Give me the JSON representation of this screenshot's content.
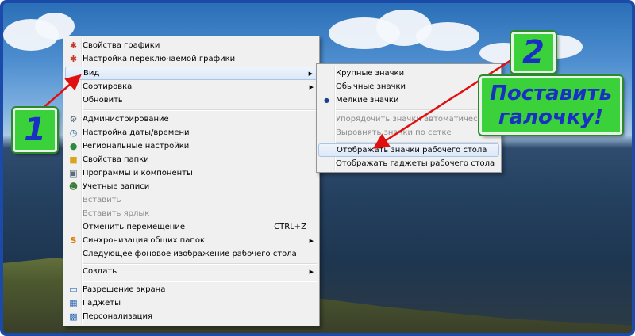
{
  "context_menu": {
    "items": [
      {
        "label": "Свойства графики",
        "icon": "intel-graphics-icon"
      },
      {
        "label": "Настройка переключаемой графики",
        "icon": "intel-graphics-icon"
      },
      {
        "label": "Вид",
        "submenu": true
      },
      {
        "label": "Сортировка",
        "submenu": true
      },
      {
        "label": "Обновить"
      },
      {
        "label": "Администрирование",
        "icon": "admin-tools-icon"
      },
      {
        "label": "Настройка даты/времени",
        "icon": "clock-icon"
      },
      {
        "label": "Региональные настройки",
        "icon": "globe-icon"
      },
      {
        "label": "Свойства папки",
        "icon": "folder-options-icon"
      },
      {
        "label": "Программы и компоненты",
        "icon": "programs-icon"
      },
      {
        "label": "Учетные записи",
        "icon": "users-icon"
      },
      {
        "label": "Вставить",
        "disabled": true
      },
      {
        "label": "Вставить ярлык",
        "disabled": true
      },
      {
        "label": "Отменить перемещение",
        "shortcut": "CTRL+Z"
      },
      {
        "label": "Синхронизация общих папок",
        "icon": "sync-icon",
        "submenu": true
      },
      {
        "label": "Следующее фоновое изображение рабочего стола"
      },
      {
        "label": "Создать",
        "submenu": true
      },
      {
        "label": "Разрешение экрана",
        "icon": "display-icon"
      },
      {
        "label": "Гаджеты",
        "icon": "gadgets-icon"
      },
      {
        "label": "Персонализация",
        "icon": "personalization-icon"
      }
    ]
  },
  "view_submenu": {
    "items": [
      {
        "label": "Крупные значки"
      },
      {
        "label": "Обычные значки"
      },
      {
        "label": "Мелкие значки",
        "selected": true
      },
      {
        "label": "Упорядочить значки автоматически",
        "disabled": true
      },
      {
        "label": "Выровнять значки по сетке",
        "disabled": true
      },
      {
        "label": "Отображать значки рабочего стола",
        "highlighted": true
      },
      {
        "label": "Отображать гаджеты  рабочего стола"
      }
    ]
  },
  "annotations": {
    "badge_1": "1",
    "badge_2": "2",
    "callout_line1": "Поставить",
    "callout_line2": "галочку!"
  },
  "colors": {
    "badge_bg": "#3ad13a",
    "badge_text": "#1a2fc4",
    "arrow": "#e01010",
    "frame_border": "#1c4aa8"
  }
}
